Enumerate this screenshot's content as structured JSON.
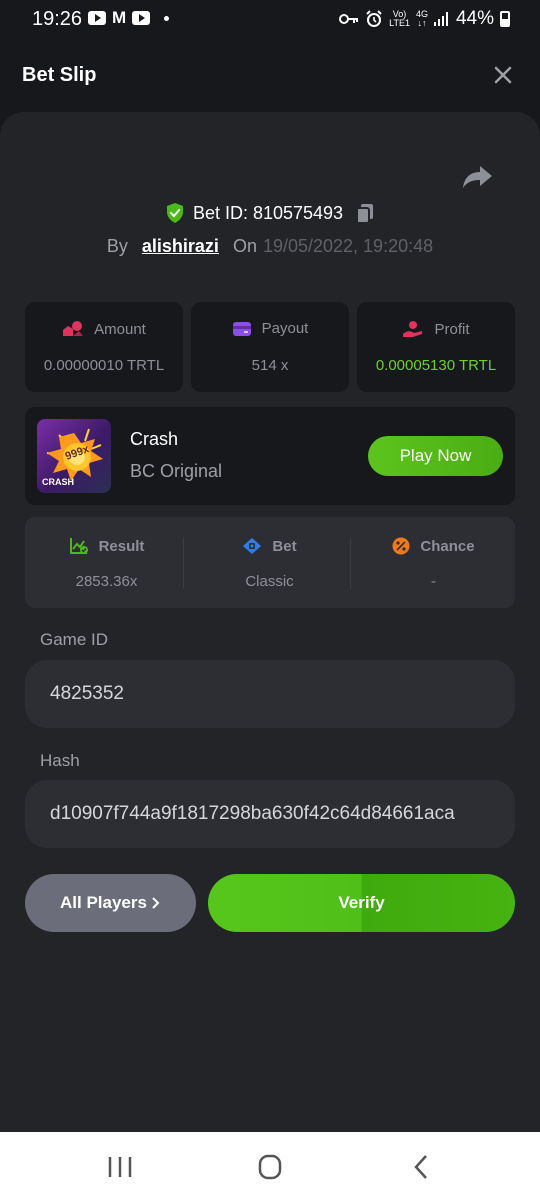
{
  "status_bar": {
    "time": "19:26",
    "network_top": "Vo)",
    "network_bottom": "LTE1",
    "net_4g_top": "4G",
    "net_4g_bottom": "↓↑",
    "battery": "44%"
  },
  "header": {
    "title": "Bet Slip"
  },
  "bet": {
    "id_label": "Bet ID: 810575493",
    "by_label": "By",
    "user": "alishirazi",
    "on_label": "On",
    "date": "19/05/2022, 19:20:48"
  },
  "stats": [
    {
      "label": "Amount",
      "value": "0.00000010 TRTL",
      "icon": "amount-icon"
    },
    {
      "label": "Payout",
      "value": "514 x",
      "icon": "payout-icon"
    },
    {
      "label": "Profit",
      "value": "0.00005130 TRTL",
      "icon": "profit-icon"
    }
  ],
  "game": {
    "name": "Crash",
    "subtitle": "BC Original",
    "play_label": "Play Now",
    "thumb_badge": "999x",
    "thumb_label": "CRASH"
  },
  "result": [
    {
      "label": "Result",
      "value": "2853.36x",
      "icon": "result-icon"
    },
    {
      "label": "Bet",
      "value": "Classic",
      "icon": "bet-icon"
    },
    {
      "label": "Chance",
      "value": "-",
      "icon": "chance-icon"
    }
  ],
  "fields": {
    "game_id_label": "Game ID",
    "game_id_value": "4825352",
    "hash_label": "Hash",
    "hash_value": "d10907f744a9f1817298ba630f42c64d84661aca"
  },
  "actions": {
    "all_players": "All Players",
    "verify": "Verify"
  },
  "colors": {
    "accent_green": "#5dc41e",
    "profit_green": "#6bd02c",
    "background": "#17181b",
    "sheet": "#232428"
  }
}
